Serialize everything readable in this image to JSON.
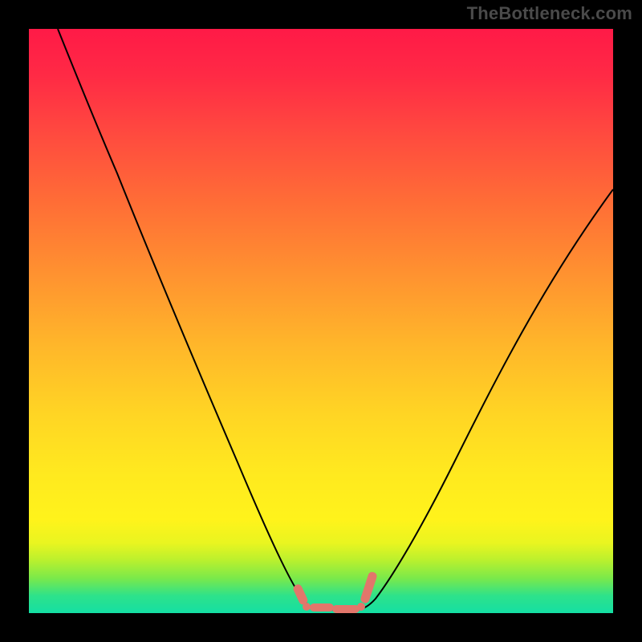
{
  "watermark": {
    "text": "TheBottleneck.com"
  },
  "chart_data": {
    "type": "line",
    "title": "",
    "xlabel": "",
    "ylabel": "",
    "xlim": [
      0,
      100
    ],
    "ylim": [
      0,
      100
    ],
    "grid": false,
    "legend": false,
    "series": [
      {
        "name": "bottleneck-curve",
        "x": [
          5,
          10,
          15,
          20,
          25,
          30,
          35,
          40,
          45,
          48,
          50,
          52,
          55,
          58,
          60,
          65,
          70,
          75,
          80,
          85,
          90,
          95,
          100
        ],
        "values": [
          100,
          90,
          77,
          65,
          53,
          42,
          31,
          21,
          10,
          4,
          1,
          0,
          0,
          1,
          4,
          12,
          22,
          32,
          42,
          51,
          59,
          66,
          72
        ]
      }
    ],
    "annotations": [
      {
        "name": "marker-left",
        "x": 47,
        "y": 2
      },
      {
        "name": "marker-right",
        "x": 58,
        "y": 2
      },
      {
        "name": "floor-segment",
        "x_start": 49,
        "x_end": 56,
        "y": 0.5
      }
    ],
    "background_gradient": {
      "top": "#ff1a47",
      "mid1": "#ff9230",
      "mid2": "#ffe91f",
      "bottom": "#14dfa4"
    }
  }
}
